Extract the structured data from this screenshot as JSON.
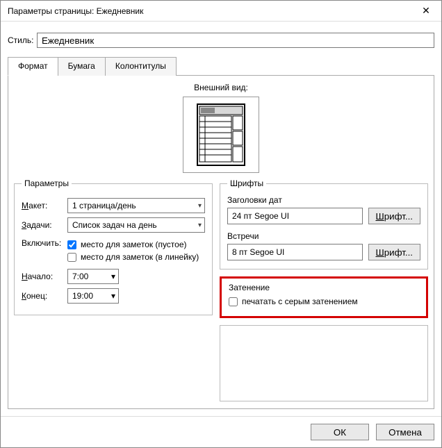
{
  "window": {
    "title": "Параметры страницы: Ежедневник"
  },
  "style_row": {
    "label": "Стиль:",
    "value": "Ежедневник"
  },
  "tabs": [
    {
      "label": "Формат"
    },
    {
      "label": "Бумага"
    },
    {
      "label": "Колонтитулы"
    }
  ],
  "preview": {
    "label": "Внешний вид:"
  },
  "params": {
    "legend": "Параметры",
    "layout_label": "Макет:",
    "layout_value": "1 страница/день",
    "tasks_label": "Задачи:",
    "tasks_value": "Список задач на день",
    "include_label": "Включить:",
    "notes_blank": "место для заметок (пустое)",
    "notes_lined": "место для заметок (в линейку)",
    "start_label": "Начало:",
    "start_value": "7:00",
    "end_label": "Конец:",
    "end_value": "19:00"
  },
  "fonts": {
    "legend": "Шрифты",
    "date_headers_label": "Заголовки дат",
    "date_headers_value": "24 пт Segoe UI",
    "appointments_label": "Встречи",
    "appointments_value": "8 пт Segoe UI",
    "font_button": "Шрифт..."
  },
  "shading": {
    "legend": "Затенение",
    "print_gray": "печатать с серым затенением"
  },
  "footer": {
    "ok": "ОК",
    "cancel": "Отмена"
  },
  "hotkeys": {
    "layout_first": "М",
    "layout_rest": "акет:",
    "tasks_first": "З",
    "tasks_rest": "адачи:",
    "start_first": "Н",
    "start_rest": "ачало:",
    "end_first": "К",
    "end_rest": "онец:",
    "font_first": "Ш",
    "font_rest": "рифт..."
  }
}
